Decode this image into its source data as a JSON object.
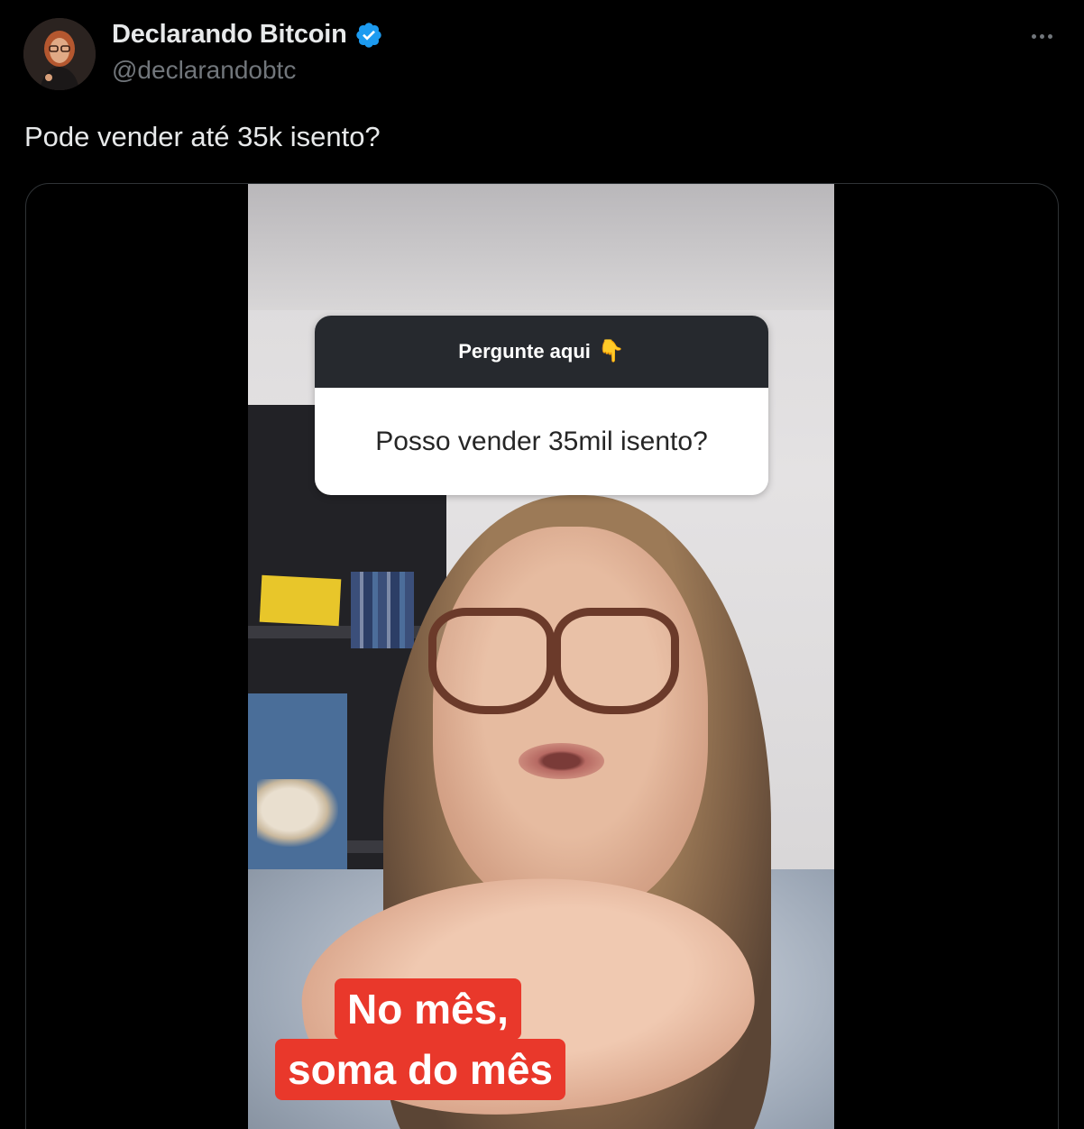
{
  "author": {
    "display_name": "Declarando Bitcoin",
    "handle": "@declarandobtc",
    "verified": true,
    "verified_icon": "verified-badge-icon",
    "verified_color": "#1d9bf0"
  },
  "tweet": {
    "text": "Pode vender até 35k isento?"
  },
  "video": {
    "sticker_header": "Pergunte aqui",
    "sticker_emoji": "👇",
    "sticker_question": "Posso vender 35mil isento?",
    "caption_line_1": "No mês,",
    "caption_line_2": "soma do mês",
    "caption_color": "#e9382b"
  },
  "colors": {
    "background": "#000000",
    "text_primary": "#e7e9ea",
    "text_secondary": "#71767b"
  }
}
